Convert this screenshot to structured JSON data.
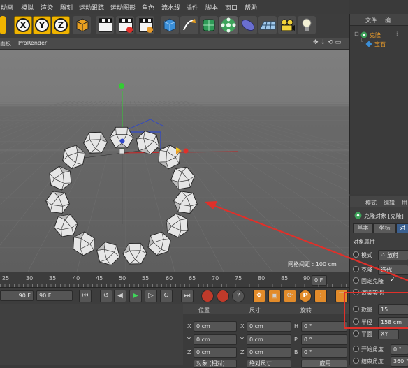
{
  "menu": [
    "动画",
    "模拟",
    "渲染",
    "雕刻",
    "运动跟踪",
    "运动图形",
    "角色",
    "流水线",
    "插件",
    "脚本",
    "窗口",
    "帮助"
  ],
  "toolbar": {
    "axis_buttons": [
      "X",
      "Y",
      "Z"
    ],
    "icons": [
      "undo-icon",
      "x-axis-lock-icon",
      "y-axis-lock-icon",
      "z-axis-lock-icon",
      "world-coordinates-icon",
      "render-view-icon",
      "render-to-picture-viewer-icon",
      "edit-render-settings-icon",
      "cube-primitive-icon",
      "pen-spline-icon",
      "subdivision-surface-icon",
      "cloner-icon",
      "deformer-icon",
      "floor-icon",
      "camera-icon",
      "light-icon"
    ]
  },
  "viewport": {
    "tabs": [
      "面板",
      "ProRender"
    ],
    "grid_label": "网格间距 : 100 cm"
  },
  "object_manager": {
    "tabs": [
      "文件",
      "编"
    ],
    "objects": [
      {
        "name": "克隆",
        "icon": "cloner-icon",
        "color": "#e89b2b"
      },
      {
        "name": "宝石",
        "icon": "gem-icon",
        "color": "#e89b2b"
      }
    ]
  },
  "attribute_manager": {
    "tabs": [
      "模式",
      "编辑",
      "用"
    ],
    "title": "克隆对象 [克隆]",
    "subtabs": [
      "基本",
      "坐标",
      "对"
    ],
    "section": "对象属性",
    "rows": {
      "mode_label": "模式",
      "mode_value": "放射",
      "clone_label": "克隆",
      "clone_value": "迭代",
      "fixed_clone_label": "固定克隆",
      "fixed_clone_check": "✓",
      "render_instance_label": "渲染实例",
      "count_label": "数量",
      "count_value": "15",
      "radius_label": "半径",
      "radius_value": "158 cm",
      "plane_label": "平面",
      "plane_value": "XY",
      "start_angle_label": "开始角度",
      "start_angle_value": "0 °",
      "end_angle_label": "结束角度",
      "end_angle_value": "360 °"
    }
  },
  "timeline": {
    "ticks": [
      "25",
      "30",
      "35",
      "40",
      "45",
      "50",
      "55",
      "60",
      "65",
      "70",
      "75",
      "80",
      "85",
      "90"
    ],
    "current_frame": "0 F",
    "start_field": "90 F",
    "end_field": "90 F"
  },
  "coordinates": {
    "headers": [
      "位置",
      "尺寸",
      "旋转"
    ],
    "rows": [
      {
        "axis": "X",
        "pos": "0 cm",
        "size_axis": "X",
        "size": "0 cm",
        "rot_axis": "H",
        "rot": "0 °"
      },
      {
        "axis": "Y",
        "pos": "0 cm",
        "size_axis": "Y",
        "size": "0 cm",
        "rot_axis": "P",
        "rot": "0 °"
      },
      {
        "axis": "Z",
        "pos": "0 cm",
        "size_axis": "Z",
        "size": "0 cm",
        "rot_axis": "B",
        "rot": "0 °"
      }
    ],
    "object_mode": "对象 (相对)",
    "size_mode": "绝对尺寸",
    "apply": "应用"
  },
  "colors": {
    "accent_orange": "#f0b400",
    "highlight_red": "#e0302a",
    "selected_blue": "#3a5f8f"
  }
}
